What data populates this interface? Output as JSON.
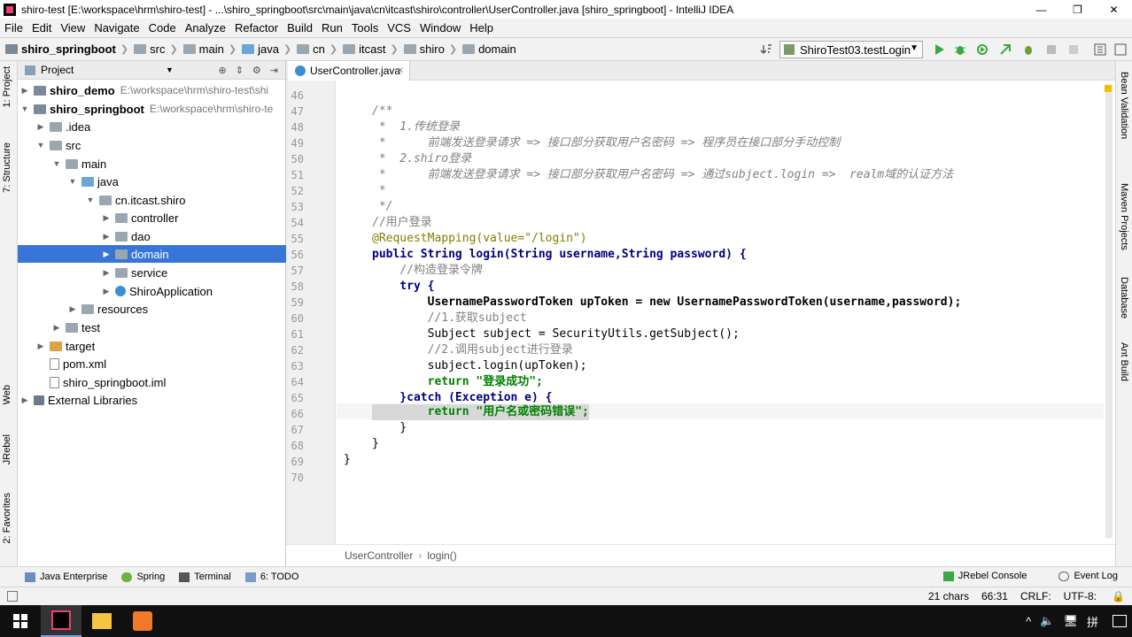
{
  "window": {
    "title": "shiro-test [E:\\workspace\\hrm\\shiro-test] - ...\\shiro_springboot\\src\\main\\java\\cn\\itcast\\shiro\\controller\\UserController.java [shiro_springboot] - IntelliJ IDEA",
    "minimize": "—",
    "maximize": "❐",
    "close": "✕"
  },
  "menu": [
    "File",
    "Edit",
    "View",
    "Navigate",
    "Code",
    "Analyze",
    "Refactor",
    "Build",
    "Run",
    "Tools",
    "VCS",
    "Window",
    "Help"
  ],
  "navbar": {
    "crumbs": [
      "shiro_springboot",
      "src",
      "main",
      "java",
      "cn",
      "itcast",
      "shiro",
      "domain"
    ],
    "run_config": "ShiroTest03.testLogin"
  },
  "left_strip": {
    "project": "1: Project",
    "structure": "7: Structure",
    "web": "Web",
    "jrebel": "JRebel",
    "favorites": "2: Favorites"
  },
  "right_strip": {
    "bean": "Bean Validation",
    "maven": "Maven Projects",
    "database": "Database",
    "ant": "Ant Build"
  },
  "project_panel": {
    "title": "Project",
    "rows": [
      {
        "label": "shiro_demo",
        "path": "E:\\workspace\\hrm\\shiro-test\\shi"
      },
      {
        "label": "shiro_springboot",
        "path": "E:\\workspace\\hrm\\shiro-te"
      },
      {
        "label": ".idea",
        "path": ""
      },
      {
        "label": "src",
        "path": ""
      },
      {
        "label": "main",
        "path": ""
      },
      {
        "label": "java",
        "path": ""
      },
      {
        "label": "cn.itcast.shiro",
        "path": ""
      },
      {
        "label": "controller",
        "path": ""
      },
      {
        "label": "dao",
        "path": ""
      },
      {
        "label": "domain",
        "path": ""
      },
      {
        "label": "service",
        "path": ""
      },
      {
        "label": "ShiroApplication",
        "path": ""
      },
      {
        "label": "resources",
        "path": ""
      },
      {
        "label": "test",
        "path": ""
      },
      {
        "label": "target",
        "path": ""
      },
      {
        "label": "pom.xml",
        "path": ""
      },
      {
        "label": "shiro_springboot.iml",
        "path": ""
      },
      {
        "label": "External Libraries",
        "path": ""
      }
    ]
  },
  "editor": {
    "tab": "UserController.java",
    "lines": [
      {
        "n": "46",
        "t": ""
      },
      {
        "n": "47",
        "t": "/**"
      },
      {
        "n": "48",
        "t": " *  1.传统登录"
      },
      {
        "n": "49",
        "t": " *      前端发送登录请求 => 接口部分获取用户名密码 => 程序员在接口部分手动控制"
      },
      {
        "n": "50",
        "t": " *  2.shiro登录"
      },
      {
        "n": "51",
        "t": " *      前端发送登录请求 => 接口部分获取用户名密码 => 通过subject.login =>  realm域的认证方法"
      },
      {
        "n": "52",
        "t": " *"
      },
      {
        "n": "53",
        "t": " */"
      },
      {
        "n": "54",
        "t": "//用户登录"
      },
      {
        "n": "55",
        "t": "@RequestMapping(value=\"/login\")"
      },
      {
        "n": "56",
        "t": "public String login(String username,String password) {"
      },
      {
        "n": "57",
        "t": "    //构造登录令牌"
      },
      {
        "n": "58",
        "t": "    try {"
      },
      {
        "n": "59",
        "t": "        UsernamePasswordToken upToken = new UsernamePasswordToken(username,password);"
      },
      {
        "n": "60",
        "t": "        //1.获取subject"
      },
      {
        "n": "61",
        "t": "        Subject subject = SecurityUtils.getSubject();"
      },
      {
        "n": "62",
        "t": "        //2.调用subject进行登录"
      },
      {
        "n": "63",
        "t": "        subject.login(upToken);"
      },
      {
        "n": "64",
        "t": "        return \"登录成功\";"
      },
      {
        "n": "65",
        "t": "    }catch (Exception e) {"
      },
      {
        "n": "66",
        "t": "        return \"用户名或密码错误\";"
      },
      {
        "n": "67",
        "t": "    }"
      },
      {
        "n": "68",
        "t": "}"
      },
      {
        "n": "69",
        "t": "}"
      },
      {
        "n": "70",
        "t": ""
      }
    ],
    "breadcrumb": [
      "UserController",
      "login()"
    ]
  },
  "bottom_tools": {
    "left": [
      "Java Enterprise",
      "Spring",
      "Terminal",
      "6: TODO"
    ],
    "right": [
      "JRebel Console",
      "Event Log"
    ]
  },
  "status": {
    "chars": "21 chars",
    "pos": "66:31",
    "crlf": "CRLF:",
    "enc": "UTF-8:"
  },
  "taskbar": {
    "tray": [
      "^",
      "🔈",
      "🖥",
      "拼"
    ]
  }
}
